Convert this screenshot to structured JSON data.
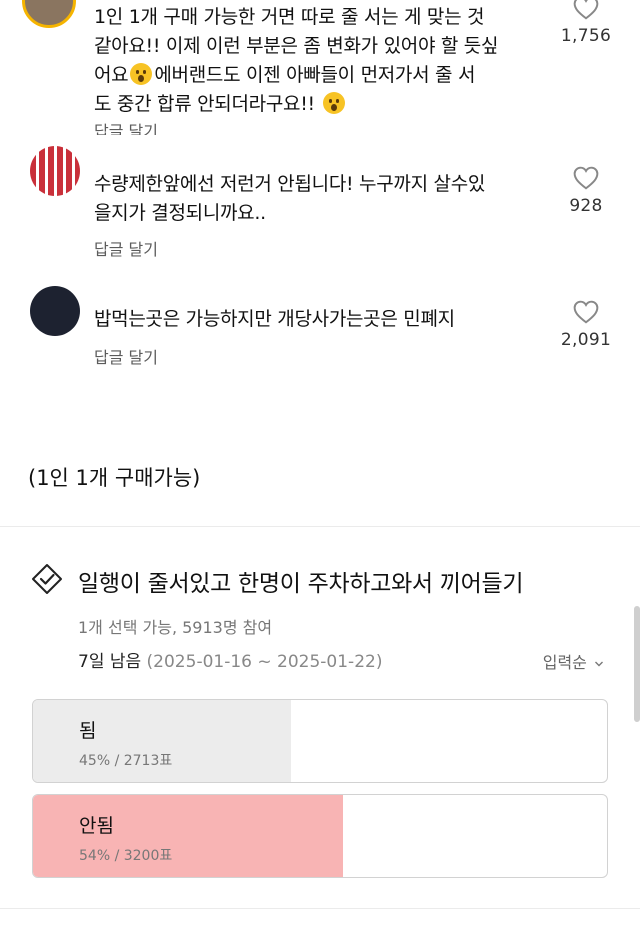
{
  "comments": [
    {
      "line1": "1인 1개 구매 가능한 거면 따로 줄 서는 게 맞는 것",
      "line2": "같아요!! 이제 이런 부분은 좀 변화가 있어야 할 듯싶",
      "line3a": "어요",
      "line3b": "에버랜드도 이젠 아빠들이 먼저가서 줄 서",
      "line4": "도 중간 합류 안되더라구요!!",
      "reply_label": "답글 달기",
      "likes": "1,756"
    },
    {
      "line1": "수량제한앞에선 저런거 안됩니다! 누구까지 살수있",
      "line2": "을지가 결정되니까요..",
      "reply_label": "답글 달기",
      "likes": "928"
    },
    {
      "line1": "밥먹는곳은 가능하지만 개당사가는곳은 민폐지",
      "reply_label": "답글 달기",
      "likes": "2,091"
    }
  ],
  "footnote": "(1인 1개 구매가능)",
  "poll": {
    "icon": "vote-check-icon",
    "title": "일행이 줄서있고 한명이 주차하고와서 끼어들기",
    "meta": "1개 선택 가능, 5913명 참여",
    "remaining": "7일 남음",
    "date_range": "(2025-01-16 ~ 2025-01-22)",
    "sort_label": "입력순",
    "options": [
      {
        "label": "됨",
        "stat": "45% / 2713표",
        "fraction": 0.45,
        "color": "#ececec"
      },
      {
        "label": "안됨",
        "stat": "54% / 3200표",
        "fraction": 0.54,
        "color": "#f8b4b4"
      }
    ]
  },
  "colors": {
    "heart_outline": "#888888",
    "divider": "#ebebeb"
  }
}
